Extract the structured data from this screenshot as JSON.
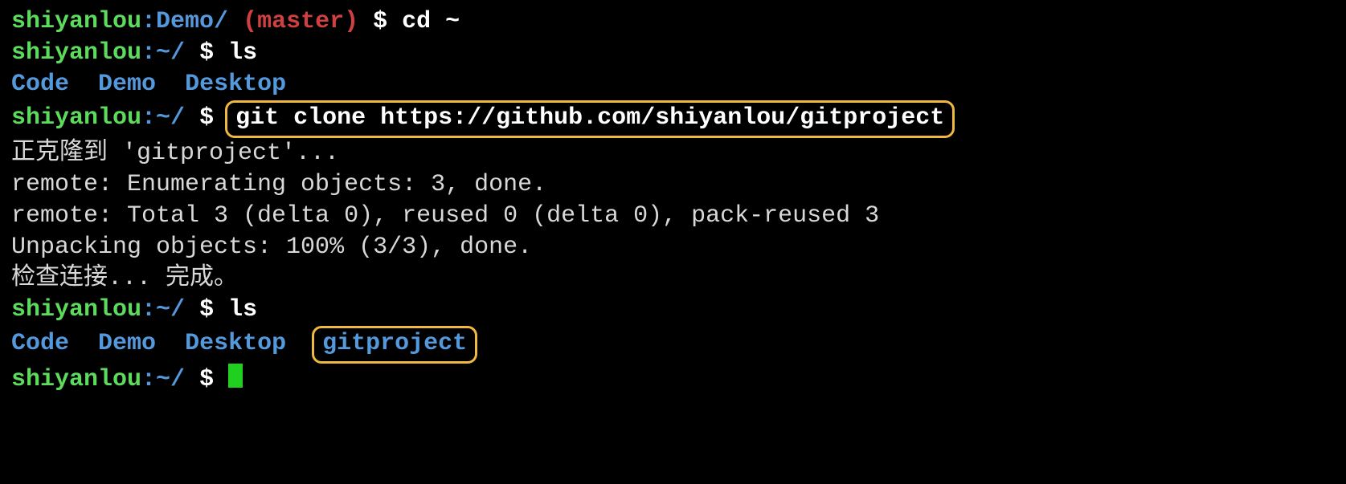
{
  "lines": {
    "l1": {
      "user": "shiyanlou",
      "path": "Demo/",
      "branch": "(master)",
      "dollar": "$",
      "cmd": "cd ~"
    },
    "l2": {
      "user": "shiyanlou",
      "path": "~/",
      "dollar": "$",
      "cmd": "ls"
    },
    "l3": {
      "d1": "Code",
      "d2": "Demo",
      "d3": "Desktop"
    },
    "l4": {
      "user": "shiyanlou",
      "path": "~/",
      "dollar": "$",
      "cmd": "git clone https://github.com/shiyanlou/gitproject"
    },
    "l5": {
      "text": "正克隆到 'gitproject'..."
    },
    "l6": {
      "text": "remote: Enumerating objects: 3, done."
    },
    "l7": {
      "text": "remote: Total 3 (delta 0), reused 0 (delta 0), pack-reused 3"
    },
    "l8": {
      "text": "Unpacking objects: 100% (3/3), done."
    },
    "l9": {
      "text": "检查连接... 完成。"
    },
    "l10": {
      "user": "shiyanlou",
      "path": "~/",
      "dollar": "$",
      "cmd": "ls"
    },
    "l11": {
      "d1": "Code",
      "d2": "Demo",
      "d3": "Desktop",
      "d4": "gitproject"
    },
    "l12": {
      "user": "shiyanlou",
      "path": "~/",
      "dollar": "$"
    }
  }
}
